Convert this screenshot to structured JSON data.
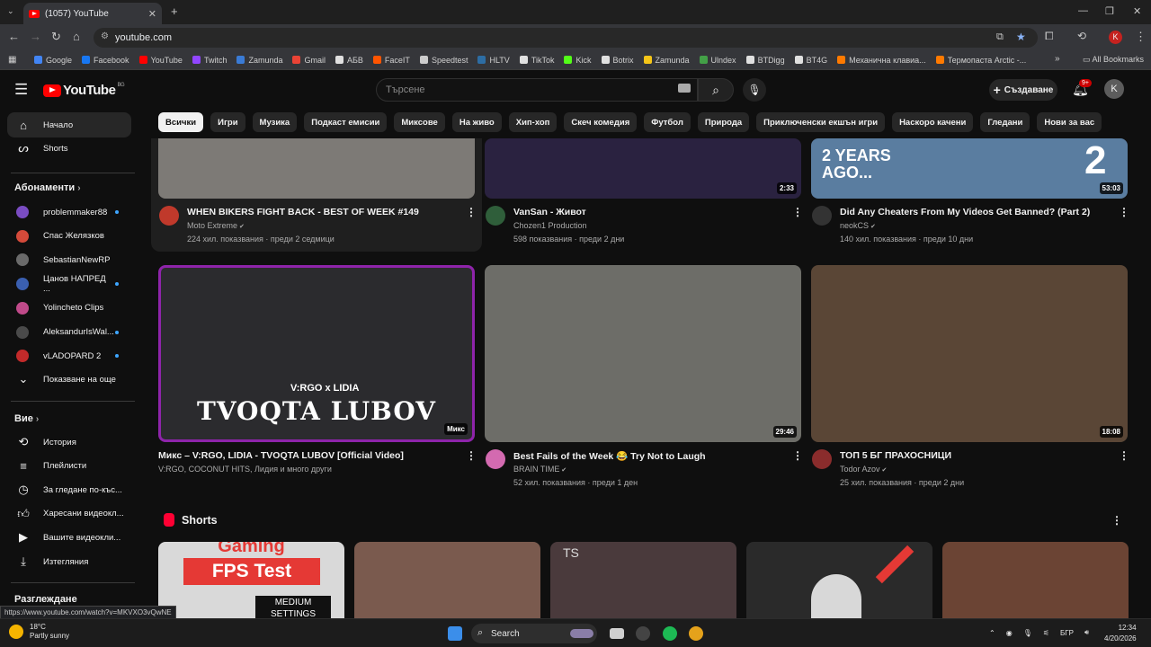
{
  "browser": {
    "tab_title": "(1057) YouTube",
    "url": "youtube.com",
    "new_tab": "+",
    "all_bookmarks": "All Bookmarks",
    "bookmarks": [
      {
        "label": "Google",
        "color": "#4285f4"
      },
      {
        "label": "Facebook",
        "color": "#1877f2"
      },
      {
        "label": "YouTube",
        "color": "#ff0000"
      },
      {
        "label": "Twitch",
        "color": "#9146ff"
      },
      {
        "label": "Zamunda",
        "color": "#3a7bd5"
      },
      {
        "label": "Gmail",
        "color": "#ea4335"
      },
      {
        "label": "АБВ",
        "color": "#e0e0e0"
      },
      {
        "label": "FaceIT",
        "color": "#ff5500"
      },
      {
        "label": "Speedtest",
        "color": "#cccccc"
      },
      {
        "label": "HLTV",
        "color": "#2d6da3"
      },
      {
        "label": "TikTok",
        "color": "#e0e0e0"
      },
      {
        "label": "Kick",
        "color": "#53fc18"
      },
      {
        "label": "Botrix",
        "color": "#e0e0e0"
      },
      {
        "label": "Zamunda",
        "color": "#f5c518"
      },
      {
        "label": "Ulndex",
        "color": "#43a047"
      },
      {
        "label": "BTDigg",
        "color": "#e0e0e0"
      },
      {
        "label": "BT4G",
        "color": "#e0e0e0"
      },
      {
        "label": "Механична клавиа...",
        "color": "#ff7a00"
      },
      {
        "label": "Термопаста Arctic -...",
        "color": "#ff7a00"
      }
    ]
  },
  "header": {
    "logo": "YouTube",
    "region": "BG",
    "search_placeholder": "Търсене",
    "create_label": "Създаване",
    "notifications": "9+",
    "avatar_letter": "K"
  },
  "chips": [
    "Всички",
    "Игри",
    "Музика",
    "Подкаст емисии",
    "Миксове",
    "На живо",
    "Хип-хоп",
    "Скеч комедия",
    "Футбол",
    "Природа",
    "Приключенски екшън игри",
    "Наскоро качени",
    "Гледани",
    "Нови за вас"
  ],
  "sidebar": {
    "home": "Начало",
    "shorts": "Shorts",
    "subscriptions_title": "Абонаменти",
    "subscriptions": [
      {
        "name": "problemmaker88",
        "color": "#7a4cc2",
        "dot": true
      },
      {
        "name": "Спас Желязков",
        "color": "#d44a3a",
        "dot": false
      },
      {
        "name": "SebastianNewRP",
        "color": "#6a6a6a",
        "dot": false
      },
      {
        "name": "Цанов НАПРЕД ...",
        "color": "#3a5fb0",
        "dot": true
      },
      {
        "name": "Yolincheto Clips",
        "color": "#c04a8a",
        "dot": false
      },
      {
        "name": "AleksandurIsWal...",
        "color": "#4a4a4a",
        "dot": true
      },
      {
        "name": "vLADOPARD 2",
        "color": "#c22a2a",
        "dot": true
      }
    ],
    "show_more": "Показване на още",
    "you_title": "Вие",
    "you_items": [
      {
        "label": "История",
        "icon": "history-icon"
      },
      {
        "label": "Плейлисти",
        "icon": "playlists-icon"
      },
      {
        "label": "За гледане по-къс...",
        "icon": "watch-later-icon"
      },
      {
        "label": "Харесани видеокл...",
        "icon": "liked-icon"
      },
      {
        "label": "Вашите видеокли...",
        "icon": "your-videos-icon"
      },
      {
        "label": "Изтегляния",
        "icon": "downloads-icon"
      }
    ],
    "explore_title": "Разглеждане"
  },
  "videos_row1": [
    {
      "title": "WHEN BIKERS FIGHT BACK - BEST OF WEEK #149",
      "channel": "Moto Extreme",
      "verified": true,
      "meta": "224 хил. показвания · преди 2 седмици",
      "duration": "",
      "thumb": "#7d7a76",
      "chan_color": "#c0392b"
    },
    {
      "title": "VanSan - Живот",
      "channel": "Chozen1 Production",
      "verified": false,
      "meta": "598 показвания · преди 2 дни",
      "duration": "2:33",
      "thumb": "#2a2240",
      "chan_color": "#2f5e3a"
    },
    {
      "title": "Did Any Cheaters From My Videos Get Banned? (Part 2)",
      "channel": "neokCS",
      "verified": true,
      "meta": "140 хил. показвания · преди 10 дни",
      "duration": "53:03",
      "thumb": "#5a7da0",
      "chan_color": "#333333"
    }
  ],
  "videos_row2": [
    {
      "title": "Микс – V:RGO, LIDIA - TVOQTA LUBOV [Official Video]",
      "channel": "V:RGO, COCONUT HITS, Лидия и много други",
      "verified": false,
      "meta": "",
      "duration": "Микс",
      "thumb": "#2b2b2e",
      "overlay": "TVOQTA LUBOV",
      "overlay_small": "V:RGO x LIDIA"
    },
    {
      "title": "Best Fails of the Week 😂 Try Not to Laugh",
      "channel": "BRAIN TIME",
      "verified": true,
      "meta": "52 хил. показвания · преди 1 ден",
      "duration": "29:46",
      "thumb": "#6d6d68",
      "chan_color": "#d36ab0"
    },
    {
      "title": "ТОП 5 БГ ПРАХОСНИЦИ",
      "channel": "Todor Azov",
      "verified": true,
      "meta": "25 хил. показвания · преди 2 дни",
      "duration": "18:08",
      "thumb": "#5a4636",
      "chan_color": "#8a2c2c"
    }
  ],
  "thumb_texts": {
    "years_ago": "2 YEARS AGO...",
    "big_number": "2"
  },
  "shorts": {
    "title": "Shorts",
    "items": [
      {
        "color": "#d9d9d9",
        "text1": "Gaming",
        "text2": "FPS Test",
        "text3": "MEDIUM SETTINGS"
      },
      {
        "color": "#7a5a4e"
      },
      {
        "color": "#4a3a3c",
        "text1": "TS"
      },
      {
        "color": "#2a2a2a"
      },
      {
        "color": "#6b4434"
      }
    ]
  },
  "status_url": "https://www.youtube.com/watch?v=MKVXO3vQwNE",
  "taskbar": {
    "temp": "18°C",
    "weather": "Partly sunny",
    "search": "Search",
    "lang": "БГР",
    "time": "12:34",
    "date": "4/20/2026"
  }
}
